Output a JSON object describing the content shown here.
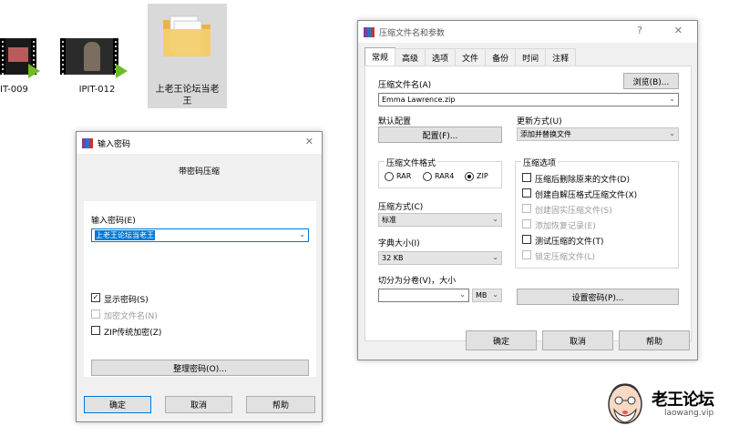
{
  "desktop": {
    "files": [
      {
        "label": "IT-009"
      },
      {
        "label": "IPIT-012"
      },
      {
        "label": "上老王论坛当老王"
      }
    ]
  },
  "password_dialog": {
    "title": "输入密码",
    "close_glyph": "✕",
    "heading": "带密码压缩",
    "password_label": "输入密码(E)",
    "password_value": "上老王论坛当老王",
    "show_password_label": "显示密码(S)",
    "show_password_checked": true,
    "encrypt_names_label": "加密文件名(N)",
    "zip_legacy_label": "ZIP传统加密(Z)",
    "organize_button": "整理密码(O)...",
    "ok_button": "确定",
    "cancel_button": "取消",
    "help_button": "帮助"
  },
  "archive_dialog": {
    "title": "压缩文件名和参数",
    "help_glyph": "?",
    "close_glyph": "✕",
    "tabs": [
      "常规",
      "高级",
      "选项",
      "文件",
      "备份",
      "时间",
      "注释"
    ],
    "active_tab": "常规",
    "archive_name_label": "压缩文件名(A)",
    "browse_button": "浏览(B)...",
    "archive_name_value": "Emma Lawrence.zip",
    "default_profile_label": "默认配置",
    "profile_button": "配置(F)...",
    "update_mode_label": "更新方式(U)",
    "update_mode_value": "添加并替换文件",
    "format_group_label": "压缩文件格式",
    "formats": [
      "RAR",
      "RAR4",
      "ZIP"
    ],
    "selected_format": "ZIP",
    "method_label": "压缩方式(C)",
    "method_value": "标准",
    "dict_label": "字典大小(I)",
    "dict_value": "32 KB",
    "split_label": "切分为分卷(V)，大小",
    "split_unit": "MB",
    "options_group_label": "压缩选项",
    "options": [
      {
        "label": "压缩后删除原来的文件(D)",
        "enabled": true,
        "checked": false
      },
      {
        "label": "创建自解压格式压缩文件(X)",
        "enabled": true,
        "checked": false
      },
      {
        "label": "创建固实压缩文件(S)",
        "enabled": false,
        "checked": false
      },
      {
        "label": "添加恢复记录(E)",
        "enabled": false,
        "checked": false
      },
      {
        "label": "测试压缩的文件(T)",
        "enabled": true,
        "checked": false
      },
      {
        "label": "锁定压缩文件(L)",
        "enabled": false,
        "checked": false
      }
    ],
    "set_password_button": "设置密码(P)...",
    "ok_button": "确定",
    "cancel_button": "取消",
    "help_button": "帮助"
  },
  "logo": {
    "name": "老王论坛",
    "url": "laowang.vip"
  }
}
